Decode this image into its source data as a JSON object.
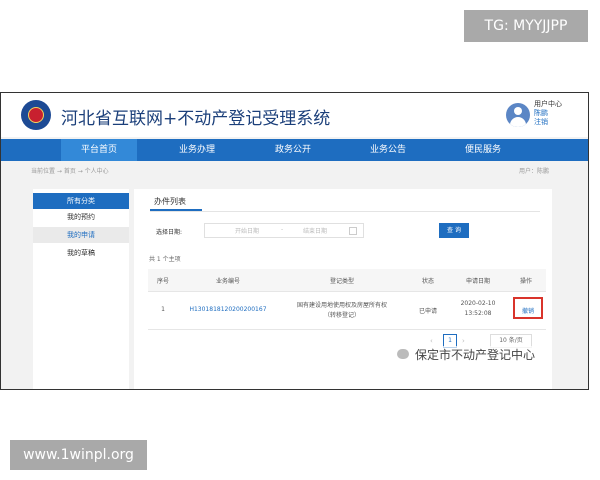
{
  "overlays": {
    "top_right_badge": "TG: MYYJJPP",
    "bottom_left_badge": "www.1winpl.org",
    "watermark": "保定市不动产登记中心"
  },
  "header": {
    "title": "河北省互联网+不动产登记受理系统",
    "user_center_label": "用户中心",
    "user_name": "陈鹏",
    "logout_label": "注销"
  },
  "nav": {
    "items": [
      {
        "label": "平台首页"
      },
      {
        "label": "业务办理"
      },
      {
        "label": "政务公开"
      },
      {
        "label": "业务公告"
      },
      {
        "label": "便民服务"
      }
    ]
  },
  "breadcrumb": {
    "text": "当前位置 → 首页 → 个人中心",
    "right_text": "用户：陈鹏"
  },
  "sidebar": {
    "items": [
      {
        "label": "所有分类"
      },
      {
        "label": "我的预约"
      },
      {
        "label": "我的申请"
      },
      {
        "label": "我的草稿"
      }
    ]
  },
  "panel": {
    "tab_label": "办件列表",
    "date_label": "选择日期:",
    "date_start_placeholder": "开始日期",
    "date_separator": "-",
    "date_end_placeholder": "结束日期",
    "search_button": "查 询",
    "count_text": "共 1 个主项"
  },
  "table": {
    "headers": [
      "序号",
      "业务编号",
      "登记类型",
      "状态",
      "申请日期",
      "操作"
    ],
    "rows": [
      {
        "index": "1",
        "business_no": "H1301818120200200167",
        "type_line1": "国有建设用地使用权及房屋所有权",
        "type_line2": "（转移登记）",
        "status": "已申请",
        "date_line1": "2020-02-10",
        "date_line2": "13:52:08",
        "action": "撤销"
      }
    ]
  },
  "pager": {
    "prev": "‹",
    "page": "1",
    "next": "›",
    "page_size": "10 条/页"
  },
  "colors": {
    "nav_blue": "#1e6dc0",
    "highlight_red": "#d9342b"
  }
}
